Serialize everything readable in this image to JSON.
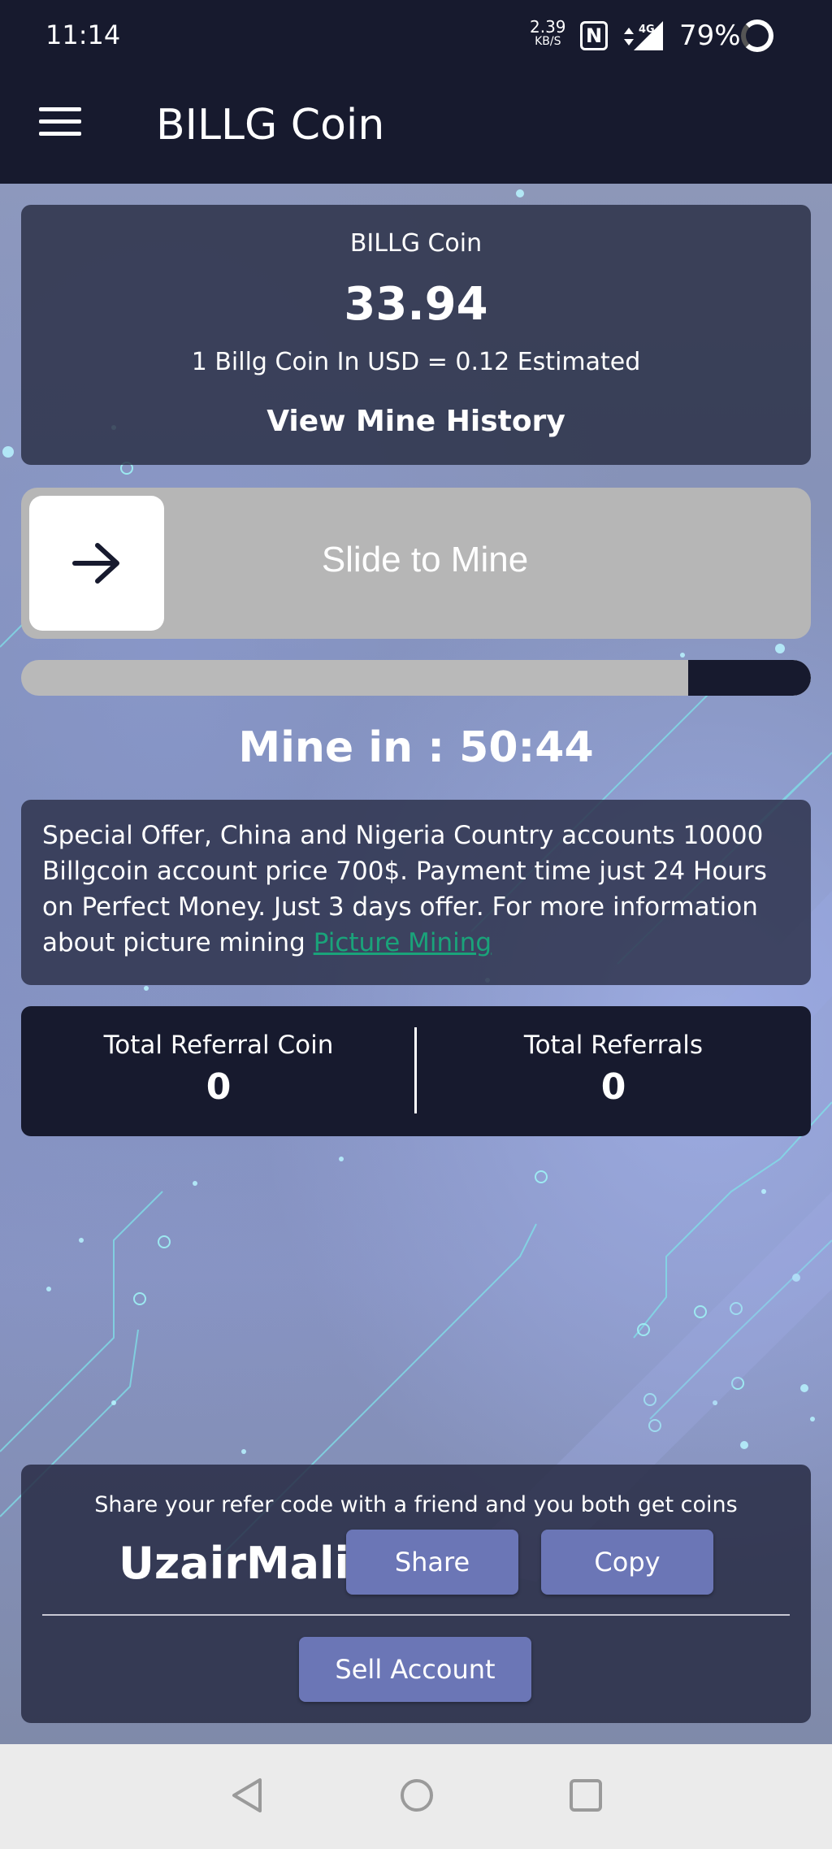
{
  "status_bar": {
    "time": "11:14",
    "net_speed": "2.39",
    "net_unit": "KB/S",
    "nfc": "N",
    "network": "4G",
    "battery": "79%"
  },
  "app_bar": {
    "title": "BILLG Coin"
  },
  "balance": {
    "title": "BILLG Coin",
    "value": "33.94",
    "rate": "1 Billg Coin In USD = 0.12 Estimated",
    "history_label": "View Mine History"
  },
  "slider": {
    "label": "Slide to Mine"
  },
  "progress": {
    "elapsed_fraction": 0.845
  },
  "timer": {
    "label": "Mine in : 50:44"
  },
  "offer": {
    "text": "Special Offer, China and Nigeria Country accounts 10000 Billgcoin account price 700$. Payment time just 24 Hours on Perfect Money. Just 3 days offer. For more information about picture mining ",
    "link_label": "Picture Mining"
  },
  "referral": {
    "coin_label": "Total Referral Coin",
    "coin_value": "0",
    "count_label": "Total Referrals",
    "count_value": "0"
  },
  "share": {
    "hint": "Share your refer code with a friend and you both get coins",
    "code": "UzairMalik",
    "share_label": "Share",
    "copy_label": "Copy",
    "sell_label": "Sell Account"
  },
  "colors": {
    "bar_bg": "#171a2e",
    "button": "#6b76b6",
    "link": "#1aa37a"
  }
}
